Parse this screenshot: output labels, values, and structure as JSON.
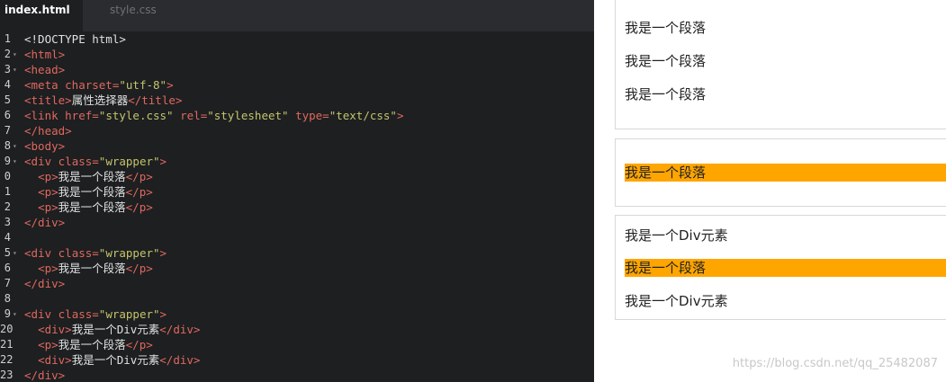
{
  "editor": {
    "tabs": [
      {
        "label": "index.html",
        "active": true
      },
      {
        "label": "style.css",
        "active": false
      }
    ],
    "lines": [
      {
        "n": "1",
        "fold": false,
        "segs": [
          [
            "plain",
            "<!DOCTYPE html>"
          ]
        ]
      },
      {
        "n": "2",
        "fold": true,
        "segs": [
          [
            "tag",
            "<html>"
          ]
        ]
      },
      {
        "n": "3",
        "fold": true,
        "segs": [
          [
            "tag",
            "<head>"
          ]
        ]
      },
      {
        "n": "4",
        "fold": false,
        "segs": [
          [
            "tag",
            "<meta "
          ],
          [
            "attr",
            "charset="
          ],
          [
            "val",
            "\"utf-8\""
          ],
          [
            "tag",
            ">"
          ]
        ]
      },
      {
        "n": "5",
        "fold": false,
        "segs": [
          [
            "tag",
            "<title>"
          ],
          [
            "plain",
            "属性选择器"
          ],
          [
            "tag",
            "</title>"
          ]
        ]
      },
      {
        "n": "6",
        "fold": false,
        "segs": [
          [
            "tag",
            "<link "
          ],
          [
            "attr",
            "href="
          ],
          [
            "val",
            "\"style.css\""
          ],
          [
            "attr",
            " rel="
          ],
          [
            "val",
            "\"stylesheet\""
          ],
          [
            "attr",
            " type="
          ],
          [
            "val",
            "\"text/css\""
          ],
          [
            "tag",
            ">"
          ]
        ]
      },
      {
        "n": "7",
        "fold": false,
        "segs": [
          [
            "tag",
            "</head>"
          ]
        ]
      },
      {
        "n": "8",
        "fold": true,
        "segs": [
          [
            "tag",
            "<body>"
          ]
        ]
      },
      {
        "n": "9",
        "fold": true,
        "segs": [
          [
            "tag",
            "<div "
          ],
          [
            "attr",
            "class="
          ],
          [
            "val",
            "\"wrapper\""
          ],
          [
            "tag",
            ">"
          ]
        ]
      },
      {
        "n": "0",
        "fold": false,
        "segs": [
          [
            "plain",
            "  "
          ],
          [
            "tag",
            "<p>"
          ],
          [
            "plain",
            "我是一个段落"
          ],
          [
            "tag",
            "</p>"
          ]
        ]
      },
      {
        "n": "1",
        "fold": false,
        "segs": [
          [
            "plain",
            "  "
          ],
          [
            "tag",
            "<p>"
          ],
          [
            "plain",
            "我是一个段落"
          ],
          [
            "tag",
            "</p>"
          ]
        ]
      },
      {
        "n": "2",
        "fold": false,
        "segs": [
          [
            "plain",
            "  "
          ],
          [
            "tag",
            "<p>"
          ],
          [
            "plain",
            "我是一个段落"
          ],
          [
            "tag",
            "</p>"
          ]
        ]
      },
      {
        "n": "3",
        "fold": false,
        "segs": [
          [
            "tag",
            "</div>"
          ]
        ]
      },
      {
        "n": "4",
        "fold": false,
        "segs": []
      },
      {
        "n": "5",
        "fold": true,
        "segs": [
          [
            "tag",
            "<div "
          ],
          [
            "attr",
            "class="
          ],
          [
            "val",
            "\"wrapper\""
          ],
          [
            "tag",
            ">"
          ]
        ]
      },
      {
        "n": "6",
        "fold": false,
        "segs": [
          [
            "plain",
            "  "
          ],
          [
            "tag",
            "<p>"
          ],
          [
            "plain",
            "我是一个段落"
          ],
          [
            "tag",
            "</p>"
          ]
        ]
      },
      {
        "n": "7",
        "fold": false,
        "segs": [
          [
            "tag",
            "</div>"
          ]
        ]
      },
      {
        "n": "8",
        "fold": false,
        "segs": []
      },
      {
        "n": "9",
        "fold": true,
        "segs": [
          [
            "tag",
            "<div "
          ],
          [
            "attr",
            "class="
          ],
          [
            "val",
            "\"wrapper\""
          ],
          [
            "tag",
            ">"
          ]
        ]
      },
      {
        "n": "20",
        "fold": false,
        "segs": [
          [
            "plain",
            "  "
          ],
          [
            "tag",
            "<div>"
          ],
          [
            "plain",
            "我是一个Div元素"
          ],
          [
            "tag",
            "</div>"
          ]
        ]
      },
      {
        "n": "21",
        "fold": false,
        "segs": [
          [
            "plain",
            "  "
          ],
          [
            "tag",
            "<p>"
          ],
          [
            "plain",
            "我是一个段落"
          ],
          [
            "tag",
            "</p>"
          ]
        ]
      },
      {
        "n": "22",
        "fold": false,
        "segs": [
          [
            "plain",
            "  "
          ],
          [
            "tag",
            "<div>"
          ],
          [
            "plain",
            "我是一个Div元素"
          ],
          [
            "tag",
            "</div>"
          ]
        ]
      },
      {
        "n": "23",
        "fold": false,
        "segs": [
          [
            "tag",
            "</div>"
          ]
        ]
      }
    ],
    "colors": {
      "tag": "#e0685e",
      "value": "#c5c56a",
      "background": "#1d1f21"
    }
  },
  "preview": {
    "wrapper1": {
      "p1": "我是一个段落",
      "p2": "我是一个段落",
      "p3": "我是一个段落"
    },
    "wrapper2": {
      "p1": "我是一个段落"
    },
    "wrapper3": {
      "div1": "我是一个Div元素",
      "p1": "我是一个段落",
      "div2": "我是一个Div元素"
    },
    "highlight_color": "#ffa500",
    "watermark": "https://blog.csdn.net/qq_25482087"
  }
}
